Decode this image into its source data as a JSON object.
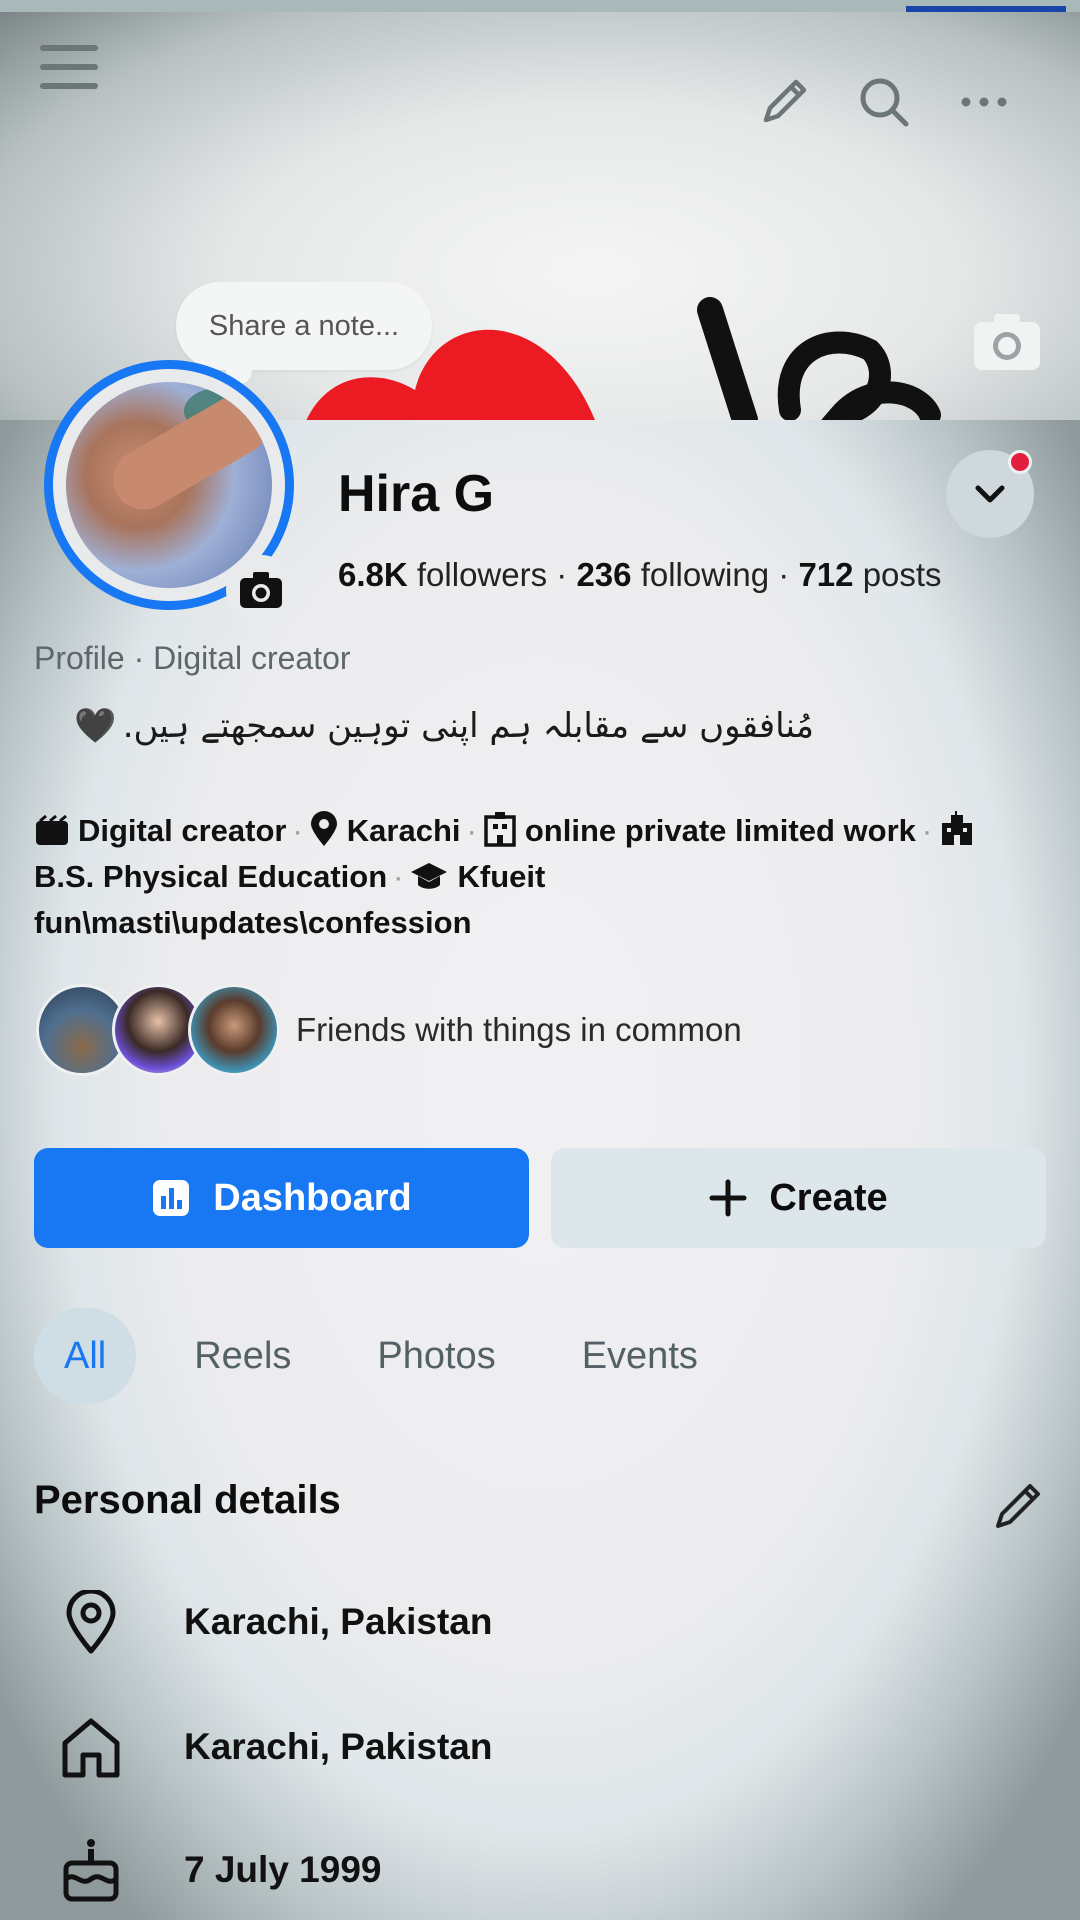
{
  "header": {
    "icons": [
      "menu-icon",
      "pencil-icon",
      "search-icon",
      "more-icon",
      "camera-icon"
    ]
  },
  "note": {
    "placeholder": "Share a note..."
  },
  "profile": {
    "name": "Hira G",
    "followers_count": "6.8K",
    "followers_label": "followers",
    "following_count": "236",
    "following_label": "following",
    "posts_count": "712",
    "posts_label": "posts",
    "type_label": "Profile · Digital creator",
    "bio_text": "مُنافقوں سے مقابلہ ہم اپنی توہین سمجھتے ہیں.",
    "bio_emoji": "🖤"
  },
  "details": {
    "category": "Digital creator",
    "location": "Karachi",
    "work": "online private limited work",
    "education": "B.S. Physical Education",
    "school": "Kfueit",
    "extra": "fun\\masti\\updates\\confession"
  },
  "friends": {
    "label": "Friends with things in common"
  },
  "actions": {
    "dashboard": "Dashboard",
    "create": "Create"
  },
  "tabs": [
    {
      "label": "All",
      "active": true
    },
    {
      "label": "Reels",
      "active": false
    },
    {
      "label": "Photos",
      "active": false
    },
    {
      "label": "Events",
      "active": false
    }
  ],
  "personal_details": {
    "title": "Personal details",
    "current_city": "Karachi, Pakistan",
    "hometown": "Karachi, Pakistan",
    "birthday": "7 July 1999"
  },
  "colors": {
    "accent": "#1877f2",
    "notification": "#e41e3f"
  }
}
